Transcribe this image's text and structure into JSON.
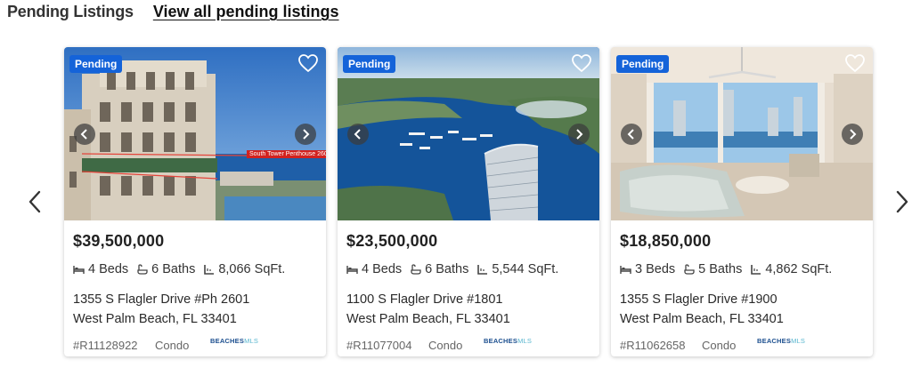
{
  "header": {
    "title": "Pending Listings",
    "view_all": "View all pending listings"
  },
  "carousel": {
    "prev_icon": "chevron-left-icon",
    "next_icon": "chevron-right-icon"
  },
  "listings": [
    {
      "status": "Pending",
      "price": "$39,500,000",
      "beds": "4 Beds",
      "baths": "6 Baths",
      "sqft": "8,066 SqFt.",
      "address_line1": "1355 S Flagler Drive #Ph 2601",
      "address_line2": "West Palm Beach, FL 33401",
      "mls_id": "#R11128922",
      "property_type": "Condo",
      "photo_tag": "South Tower Penthouse 2601"
    },
    {
      "status": "Pending",
      "price": "$23,500,000",
      "beds": "4 Beds",
      "baths": "6 Baths",
      "sqft": "5,544 SqFt.",
      "address_line1": "1100 S Flagler Drive #1801",
      "address_line2": "West Palm Beach, FL 33401",
      "mls_id": "#R11077004",
      "property_type": "Condo"
    },
    {
      "status": "Pending",
      "price": "$18,850,000",
      "beds": "3 Beds",
      "baths": "5 Baths",
      "sqft": "4,862 SqFt.",
      "address_line1": "1355 S Flagler Drive #1900",
      "address_line2": "West Palm Beach, FL 33401",
      "mls_id": "#R11062658",
      "property_type": "Condo"
    }
  ],
  "mls_logo": {
    "part1": "BEACHES",
    "part2": "MLS"
  },
  "colors": {
    "badge": "#1463d9",
    "photo_tag": "#d2221f"
  }
}
